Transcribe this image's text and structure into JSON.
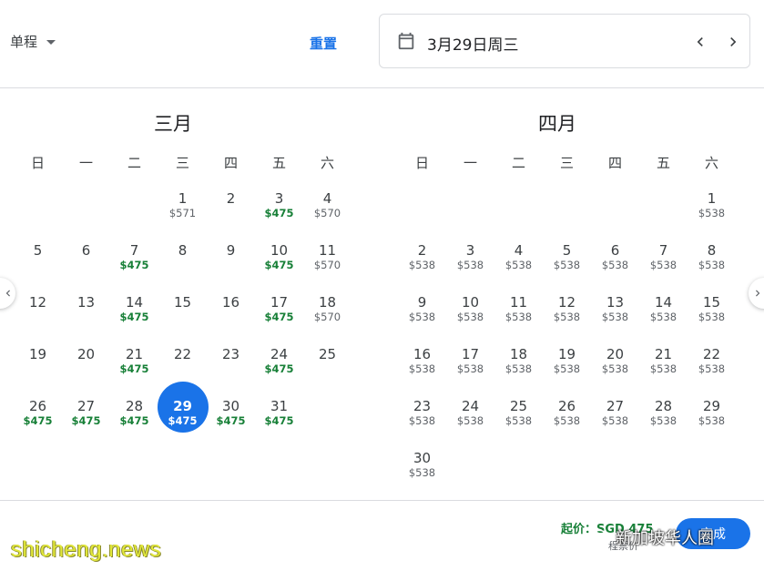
{
  "header": {
    "trip_type": "单程",
    "reset_label": "重置",
    "date_value": "3月29日周三"
  },
  "weekdays": [
    "日",
    "一",
    "二",
    "三",
    "四",
    "五",
    "六"
  ],
  "months": [
    {
      "title": "三月",
      "days": [
        null,
        null,
        null,
        {
          "d": "1",
          "p": "$571"
        },
        {
          "d": "2",
          "p": ""
        },
        {
          "d": "3",
          "p": "$475",
          "low": true
        },
        {
          "d": "4",
          "p": "$570"
        },
        {
          "d": "5",
          "p": ""
        },
        {
          "d": "6",
          "p": ""
        },
        {
          "d": "7",
          "p": "$475",
          "low": true
        },
        {
          "d": "8",
          "p": ""
        },
        {
          "d": "9",
          "p": ""
        },
        {
          "d": "10",
          "p": "$475",
          "low": true
        },
        {
          "d": "11",
          "p": "$570"
        },
        {
          "d": "12",
          "p": ""
        },
        {
          "d": "13",
          "p": ""
        },
        {
          "d": "14",
          "p": "$475",
          "low": true
        },
        {
          "d": "15",
          "p": ""
        },
        {
          "d": "16",
          "p": ""
        },
        {
          "d": "17",
          "p": "$475",
          "low": true
        },
        {
          "d": "18",
          "p": "$570"
        },
        {
          "d": "19",
          "p": ""
        },
        {
          "d": "20",
          "p": ""
        },
        {
          "d": "21",
          "p": "$475",
          "low": true
        },
        {
          "d": "22",
          "p": ""
        },
        {
          "d": "23",
          "p": ""
        },
        {
          "d": "24",
          "p": "$475",
          "low": true
        },
        {
          "d": "25",
          "p": ""
        },
        {
          "d": "26",
          "p": "$475",
          "low": true
        },
        {
          "d": "27",
          "p": "$475",
          "low": true
        },
        {
          "d": "28",
          "p": "$475",
          "low": true
        },
        {
          "d": "29",
          "p": "$475",
          "low": true,
          "selected": true
        },
        {
          "d": "30",
          "p": "$475",
          "low": true
        },
        {
          "d": "31",
          "p": "$475",
          "low": true
        }
      ]
    },
    {
      "title": "四月",
      "days": [
        null,
        null,
        null,
        null,
        null,
        null,
        {
          "d": "1",
          "p": "$538"
        },
        {
          "d": "2",
          "p": "$538"
        },
        {
          "d": "3",
          "p": "$538"
        },
        {
          "d": "4",
          "p": "$538"
        },
        {
          "d": "5",
          "p": "$538"
        },
        {
          "d": "6",
          "p": "$538"
        },
        {
          "d": "7",
          "p": "$538"
        },
        {
          "d": "8",
          "p": "$538"
        },
        {
          "d": "9",
          "p": "$538"
        },
        {
          "d": "10",
          "p": "$538"
        },
        {
          "d": "11",
          "p": "$538"
        },
        {
          "d": "12",
          "p": "$538"
        },
        {
          "d": "13",
          "p": "$538"
        },
        {
          "d": "14",
          "p": "$538"
        },
        {
          "d": "15",
          "p": "$538"
        },
        {
          "d": "16",
          "p": "$538"
        },
        {
          "d": "17",
          "p": "$538"
        },
        {
          "d": "18",
          "p": "$538"
        },
        {
          "d": "19",
          "p": "$538"
        },
        {
          "d": "20",
          "p": "$538"
        },
        {
          "d": "21",
          "p": "$538"
        },
        {
          "d": "22",
          "p": "$538"
        },
        {
          "d": "23",
          "p": "$538"
        },
        {
          "d": "24",
          "p": "$538"
        },
        {
          "d": "25",
          "p": "$538"
        },
        {
          "d": "26",
          "p": "$538"
        },
        {
          "d": "27",
          "p": "$538"
        },
        {
          "d": "28",
          "p": "$538"
        },
        {
          "d": "29",
          "p": "$538"
        },
        {
          "d": "30",
          "p": "$538"
        }
      ]
    }
  ],
  "footer": {
    "lowest_price": "起价：SGD 475",
    "note": "程票价",
    "done_label": "完成"
  },
  "watermark": {
    "site": "shicheng.news",
    "account": "新加坡华人圈"
  },
  "colors": {
    "accent": "#1a73e8",
    "low_price": "#188038"
  }
}
